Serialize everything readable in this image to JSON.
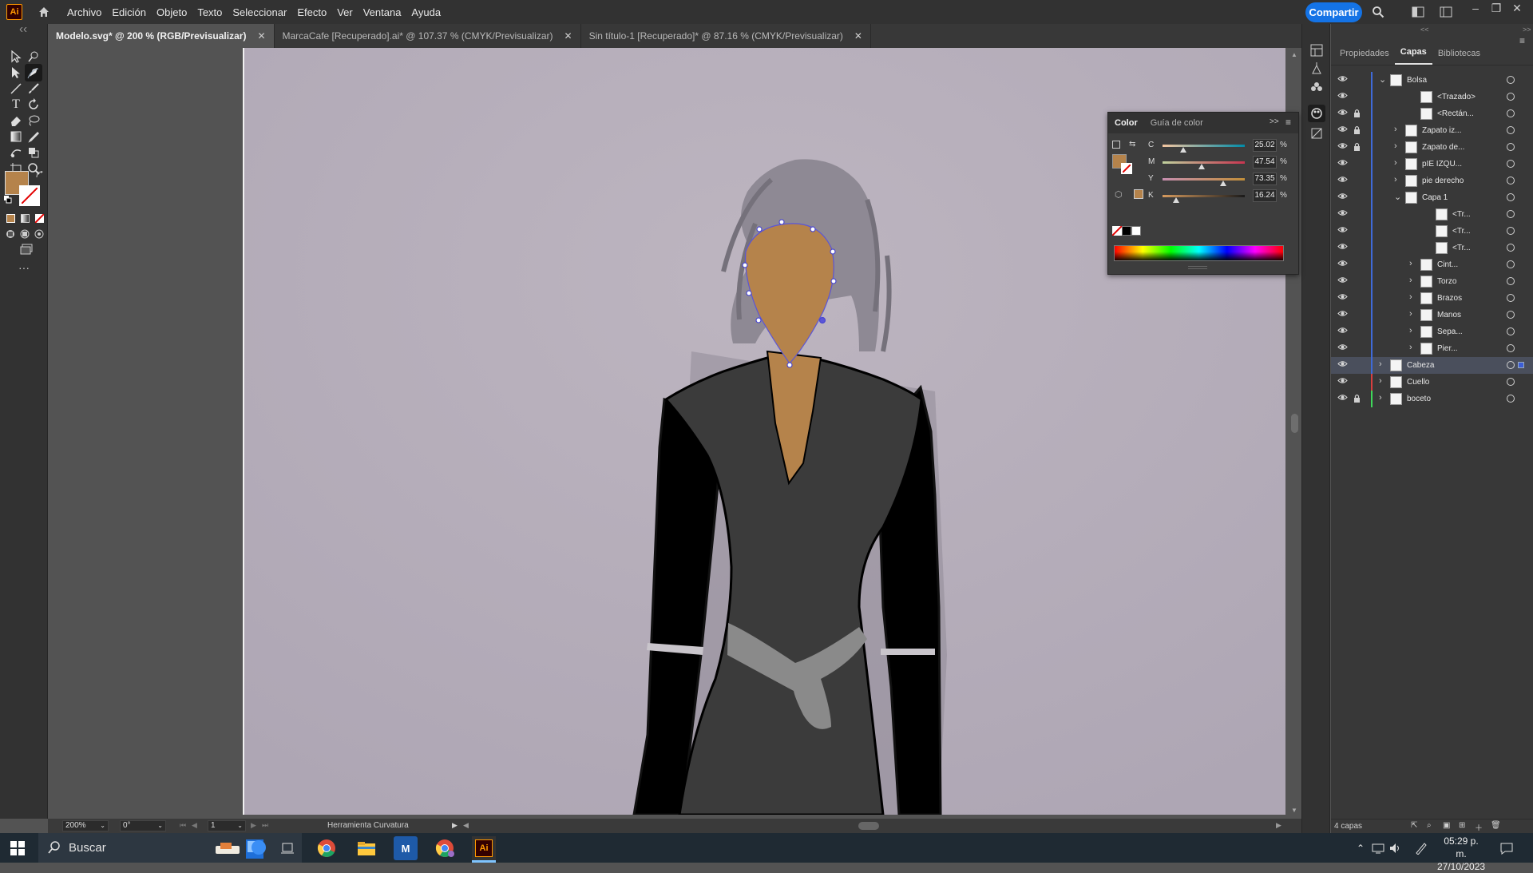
{
  "app": {
    "logo_text": "Ai",
    "share_label": "Compartir",
    "menu": [
      "Archivo",
      "Edición",
      "Objeto",
      "Texto",
      "Seleccionar",
      "Efecto",
      "Ver",
      "Ventana",
      "Ayuda"
    ],
    "window_controls": {
      "minimize": "–",
      "restore": "❐",
      "close": "✕"
    }
  },
  "tabs": [
    {
      "label": "Modelo.svg* @ 200 % (RGB/Previsualizar)",
      "active": true
    },
    {
      "label": "MarcaCafe [Recuperado].ai* @ 107.37 % (CMYK/Previsualizar)",
      "active": false
    },
    {
      "label": "Sin título-1 [Recuperado]* @ 87.16 % (CMYK/Previsualizar)",
      "active": false
    }
  ],
  "tab_close_glyph": "✕",
  "toolbar": {
    "fill_color": "#b5834b",
    "more_glyph": "···"
  },
  "status": {
    "zoom": "200%",
    "rotation": "0°",
    "artboard_number": "1",
    "tool_name": "Herramienta Curvatura"
  },
  "color_panel": {
    "tabs": [
      "Color",
      "Guía de color"
    ],
    "sliders": [
      {
        "label": "C",
        "value": "25.02",
        "pct": 0.2502,
        "gradient": "linear-gradient(90deg,#f5c6a0,#008ba8)"
      },
      {
        "label": "M",
        "value": "47.54",
        "pct": 0.4754,
        "gradient": "linear-gradient(90deg,#c0d19d,#c83550)"
      },
      {
        "label": "Y",
        "value": "73.35",
        "pct": 0.7335,
        "gradient": "linear-gradient(90deg,#c78fb0,#c28f3a)"
      },
      {
        "label": "K",
        "value": "16.24",
        "pct": 0.1624,
        "gradient": "linear-gradient(90deg,#d59a5e,#1a1a1a)"
      }
    ],
    "percent_sign": "%",
    "current_color": "#b5834b"
  },
  "layers_panel": {
    "tabs": [
      "Propiedades",
      "Capas",
      "Bibliotecas"
    ],
    "active_tab": "Capas",
    "footer_count": "4 capas",
    "rows": [
      {
        "name": "Bolsa",
        "indent": 0,
        "chev": "open",
        "lock": false,
        "bar": "#3f6ad8",
        "selected": false
      },
      {
        "name": "<Trazado>",
        "indent": 2,
        "chev": "none",
        "lock": false,
        "bar": "#3f6ad8",
        "selected": false
      },
      {
        "name": "<Rectán...",
        "indent": 2,
        "chev": "none",
        "lock": true,
        "bar": "#3f6ad8",
        "selected": false
      },
      {
        "name": "Zapato iz...",
        "indent": 1,
        "chev": "closed",
        "lock": true,
        "bar": "#3f6ad8",
        "selected": false
      },
      {
        "name": "Zapato de...",
        "indent": 1,
        "chev": "closed",
        "lock": true,
        "bar": "#3f6ad8",
        "selected": false
      },
      {
        "name": "pIE IZQU...",
        "indent": 1,
        "chev": "closed",
        "lock": false,
        "bar": "#3f6ad8",
        "selected": false
      },
      {
        "name": "pie derecho",
        "indent": 1,
        "chev": "closed",
        "lock": false,
        "bar": "#3f6ad8",
        "selected": false
      },
      {
        "name": "Capa 1",
        "indent": 1,
        "chev": "open",
        "lock": false,
        "bar": "#3f6ad8",
        "selected": false
      },
      {
        "name": "<Tr...",
        "indent": 3,
        "chev": "none",
        "lock": false,
        "bar": "#3f6ad8",
        "selected": false
      },
      {
        "name": "<Tr...",
        "indent": 3,
        "chev": "none",
        "lock": false,
        "bar": "#3f6ad8",
        "selected": false
      },
      {
        "name": "<Tr...",
        "indent": 3,
        "chev": "none",
        "lock": false,
        "bar": "#3f6ad8",
        "selected": false
      },
      {
        "name": "Cint...",
        "indent": 2,
        "chev": "closed",
        "lock": false,
        "bar": "#3f6ad8",
        "selected": false
      },
      {
        "name": "Torzo",
        "indent": 2,
        "chev": "closed",
        "lock": false,
        "bar": "#3f6ad8",
        "selected": false
      },
      {
        "name": "Brazos",
        "indent": 2,
        "chev": "closed",
        "lock": false,
        "bar": "#3f6ad8",
        "selected": false
      },
      {
        "name": "Manos",
        "indent": 2,
        "chev": "closed",
        "lock": false,
        "bar": "#3f6ad8",
        "selected": false
      },
      {
        "name": "Sepa...",
        "indent": 2,
        "chev": "closed",
        "lock": false,
        "bar": "#3f6ad8",
        "selected": false
      },
      {
        "name": "Pier...",
        "indent": 2,
        "chev": "closed",
        "lock": false,
        "bar": "#3f6ad8",
        "selected": false
      },
      {
        "name": "Cabeza",
        "indent": 0,
        "chev": "closed",
        "lock": false,
        "bar": "#3f6ad8",
        "selected": true
      },
      {
        "name": "Cuello",
        "indent": 0,
        "chev": "closed",
        "lock": false,
        "bar": "#d83f3f",
        "selected": false
      },
      {
        "name": "boceto",
        "indent": 0,
        "chev": "closed",
        "lock": true,
        "bar": "#3fd85a",
        "selected": false
      }
    ]
  },
  "taskbar": {
    "search_placeholder": "Buscar",
    "time": "05:29 p. m.",
    "date": "27/10/2023"
  }
}
